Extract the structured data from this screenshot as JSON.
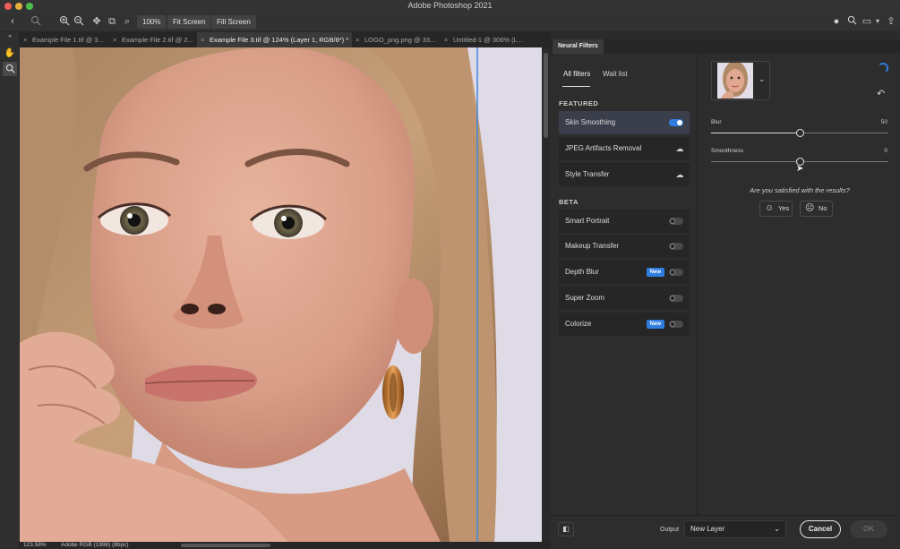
{
  "app": {
    "title": "Adobe Photoshop 2021"
  },
  "options_bar": {
    "zoom_value": "100%",
    "fit_screen_label": "Fit Screen",
    "fill_screen_label": "Fill Screen"
  },
  "tabs": [
    {
      "close": "×",
      "label": "Example File 1.tif @ 3..."
    },
    {
      "close": "×",
      "label": "Example File 2.tif @ 2..."
    },
    {
      "close": "×",
      "label": "Example File 3.tif @ 124% (Layer 1, RGB/8*) *"
    },
    {
      "close": "×",
      "label": "LOGO_png.png @ 33..."
    },
    {
      "close": "×",
      "label": "Untitled-1 @ 306% (L..."
    }
  ],
  "status": {
    "zoom": "123.58%",
    "profile": "Adobe RGB (1998) (8bpc)"
  },
  "neural_filters": {
    "panel_tab": "Neural Filters",
    "filter_tabs": {
      "all": "All filters",
      "wait": "Wait list"
    },
    "featured_title": "FEATURED",
    "beta_title": "BETA",
    "featured": [
      {
        "label": "Skin Smoothing",
        "control": "toggle",
        "on": true,
        "selected": true
      },
      {
        "label": "JPEG Artifacts Removal",
        "control": "cloud"
      },
      {
        "label": "Style Transfer",
        "control": "cloud"
      }
    ],
    "beta": [
      {
        "label": "Smart Portrait",
        "control": "toggle",
        "on": false
      },
      {
        "label": "Makeup Transfer",
        "control": "toggle",
        "on": false
      },
      {
        "label": "Depth Blur",
        "control": "toggle",
        "on": false,
        "badge": "New"
      },
      {
        "label": "Super Zoom",
        "control": "toggle",
        "on": false
      },
      {
        "label": "Colorize",
        "control": "toggle",
        "on": false,
        "badge": "New"
      }
    ],
    "settings": {
      "blur_label": "Blur",
      "blur_value": "50",
      "blur_max": 100,
      "smooth_label": "Smoothness",
      "smooth_value": "0",
      "smooth_min": -50,
      "smooth_max": 50,
      "question": "Are you satisfied with the results?",
      "yes_label": "Yes",
      "no_label": "No"
    },
    "footer": {
      "output_label": "Output",
      "output_value": "New Layer",
      "cancel_label": "Cancel",
      "ok_label": "OK"
    }
  },
  "colors": {
    "accent": "#2f7de1",
    "panel_bg": "#2d2d2d",
    "canvas_bg": "#dfdbe6",
    "guide": "#3d86e3"
  }
}
